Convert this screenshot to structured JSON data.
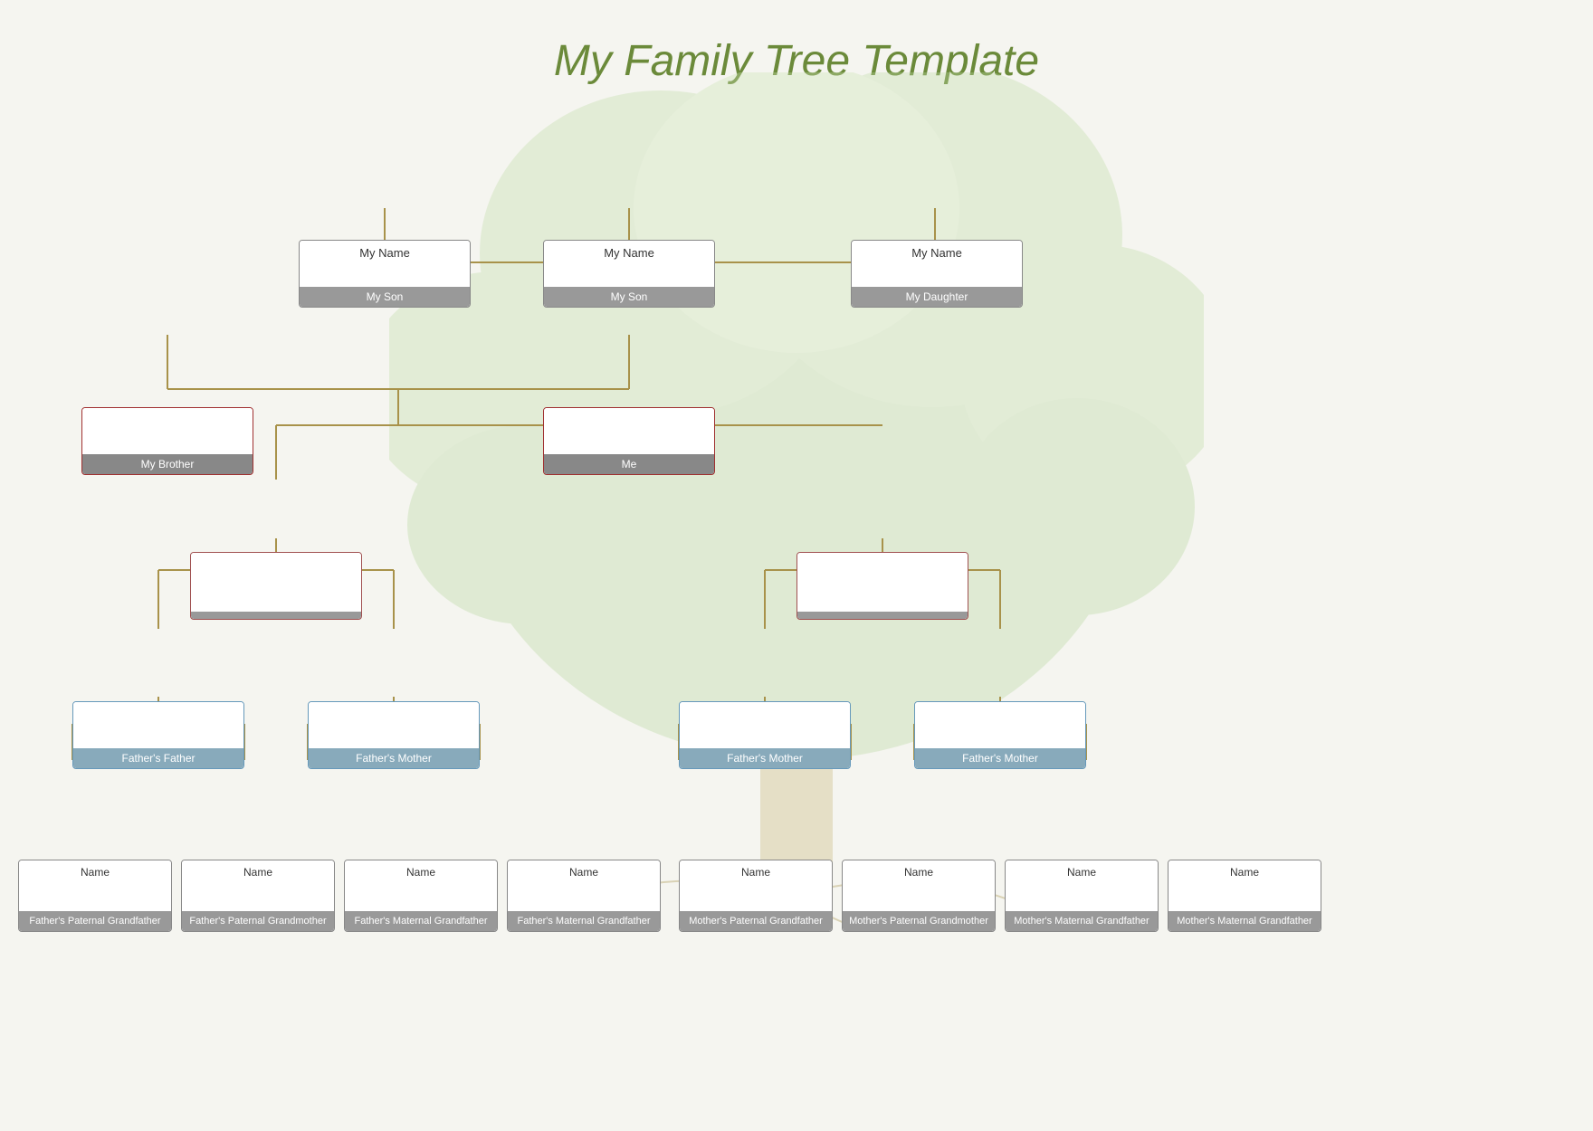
{
  "title": "My Family Tree Template",
  "nodes": {
    "son1": {
      "name": "My Name",
      "label": "My Son",
      "type": "child"
    },
    "son2": {
      "name": "My Name",
      "label": "My Son",
      "type": "child"
    },
    "daughter": {
      "name": "My Name",
      "label": "My Daughter",
      "type": "child"
    },
    "brother": {
      "name": "",
      "label": "My Brother",
      "type": "me"
    },
    "me": {
      "name": "",
      "label": "Me",
      "type": "me"
    },
    "father": {
      "name": "",
      "label": "",
      "type": "parent"
    },
    "mother": {
      "name": "",
      "label": "",
      "type": "parent"
    },
    "ff": {
      "name": "",
      "label": "Father's Father",
      "type": "gp"
    },
    "fm": {
      "name": "",
      "label": "Father's Mother",
      "type": "gp"
    },
    "mf": {
      "name": "",
      "label": "Father's Mother",
      "type": "gp"
    },
    "mm": {
      "name": "",
      "label": "Father's Mother",
      "type": "gp"
    },
    "fff": {
      "name": "Name",
      "label": "Father's Paternal Grandfather",
      "type": "ggp"
    },
    "ffm": {
      "name": "Name",
      "label": "Father's Paternal Grandmother",
      "type": "ggp"
    },
    "fmf": {
      "name": "Name",
      "label": "Father's Maternal Grandfather",
      "type": "ggp"
    },
    "fmm": {
      "name": "Name",
      "label": "Father's Maternal Grandfather",
      "type": "ggp"
    },
    "mff": {
      "name": "Name",
      "label": "Mother's Paternal Grandfather",
      "type": "ggp"
    },
    "mfm": {
      "name": "Name",
      "label": "Mother's Paternal Grandmother",
      "type": "ggp"
    },
    "mmf": {
      "name": "Name",
      "label": "Mother's Maternal Grandfather",
      "type": "ggp"
    },
    "mmm": {
      "name": "Name",
      "label": "Mother's Maternal Grandfather",
      "type": "ggp"
    }
  }
}
